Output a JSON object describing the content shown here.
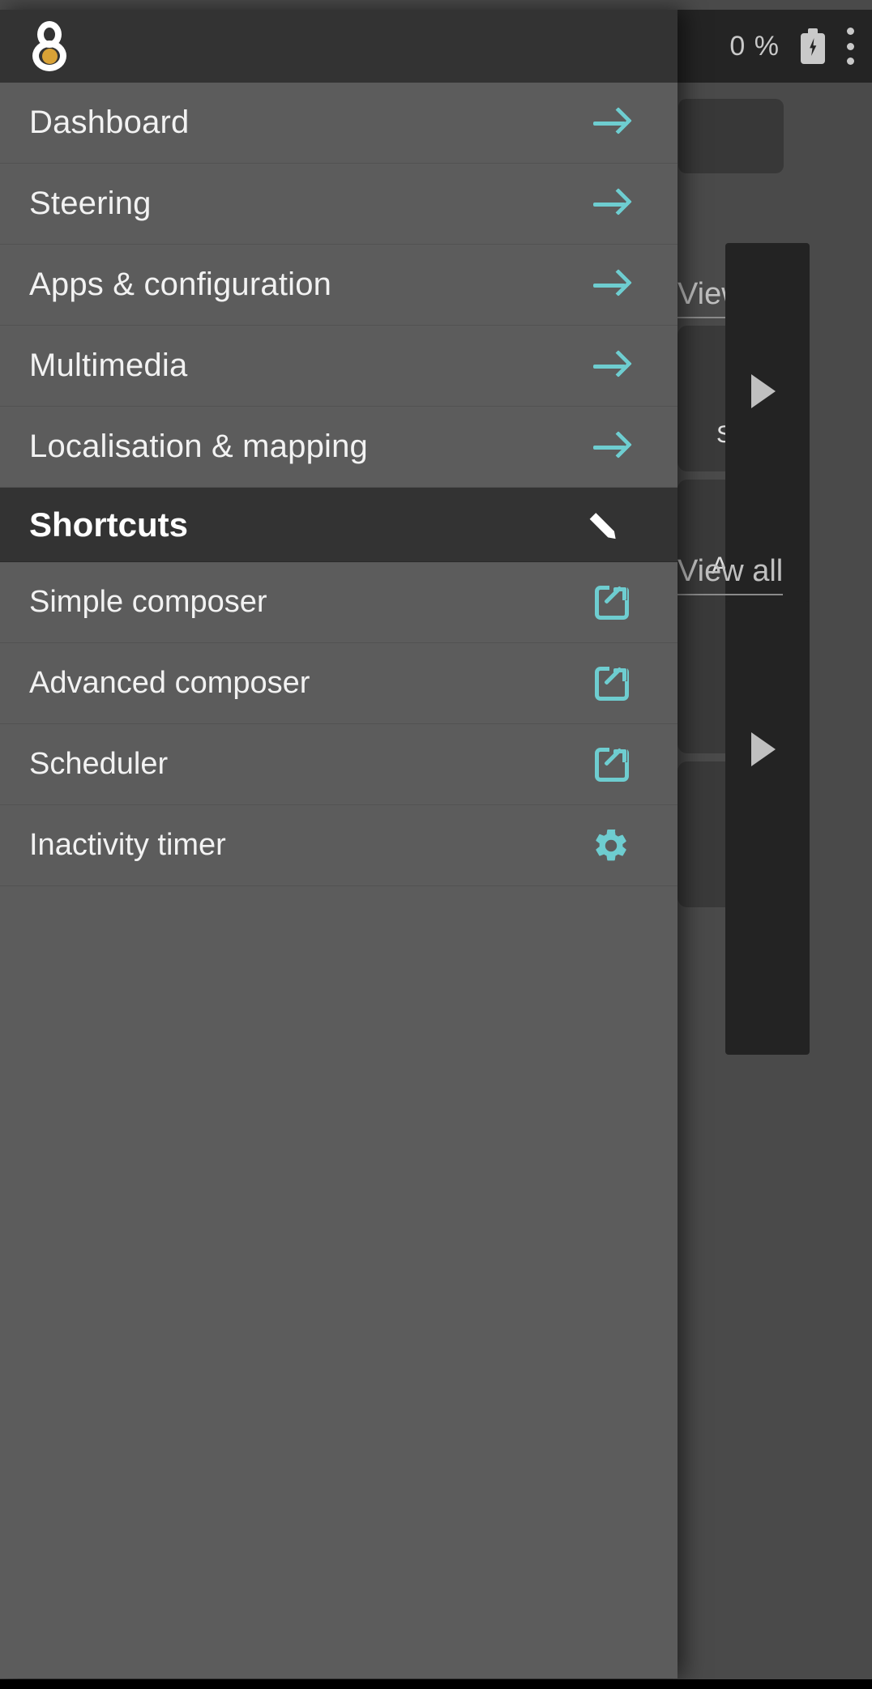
{
  "status_bar": {
    "battery_percent": "0 %",
    "battery_icon": "battery-charging-icon",
    "overflow_icon": "more-vertical-icon"
  },
  "drawer": {
    "logo_icon": "app-logo-icon",
    "nav_items": [
      {
        "label": "Dashboard",
        "icon": "arrow-right-icon"
      },
      {
        "label": "Steering",
        "icon": "arrow-right-icon"
      },
      {
        "label": "Apps & configuration",
        "icon": "arrow-right-icon"
      },
      {
        "label": "Multimedia",
        "icon": "arrow-right-icon"
      },
      {
        "label": "Localisation & mapping",
        "icon": "arrow-right-icon"
      }
    ],
    "shortcuts_section": {
      "title": "Shortcuts",
      "edit_icon": "pencil-icon",
      "items": [
        {
          "label": "Simple composer",
          "icon": "open-in-new-icon"
        },
        {
          "label": "Advanced composer",
          "icon": "open-in-new-icon"
        },
        {
          "label": "Scheduler",
          "icon": "open-in-new-icon"
        },
        {
          "label": "Inactivity timer",
          "icon": "gear-icon"
        }
      ]
    }
  },
  "background": {
    "view_all_top": "View all",
    "view_all_bottom": "View all",
    "tile_label_top": "S",
    "tile_label_bottom": "Ad",
    "play_icon": "play-arrow-icon"
  },
  "colors": {
    "accent_teal": "#6ecdd0",
    "logo_dot": "#d9a236",
    "drawer_bg": "#5c5c5c",
    "header_bg": "#333333",
    "app_bg": "#4a4a4a"
  }
}
